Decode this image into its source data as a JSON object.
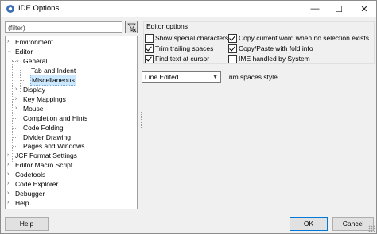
{
  "window": {
    "title": "IDE Options",
    "controls": {
      "minimize": "—",
      "maximize": "☐",
      "close": "✕"
    }
  },
  "filter": {
    "value": "(filter)"
  },
  "tree": {
    "items": [
      {
        "label": "Environment",
        "expander": "›"
      },
      {
        "label": "Editor",
        "expander": "⌄"
      },
      {
        "label": "General",
        "expander": "⌄"
      },
      {
        "label": "Tab and Indent"
      },
      {
        "label": "Miscellaneous",
        "selected": true
      },
      {
        "label": "Display",
        "expander": "›"
      },
      {
        "label": "Key Mappings",
        "expander": "›"
      },
      {
        "label": "Mouse",
        "expander": "›"
      },
      {
        "label": "Completion and Hints"
      },
      {
        "label": "Code Folding"
      },
      {
        "label": "Divider Drawing"
      },
      {
        "label": "Pages and Windows"
      },
      {
        "label": "JCF Format Settings",
        "expander": "›"
      },
      {
        "label": "Editor Macro Script",
        "expander": "›"
      },
      {
        "label": "Codetools",
        "expander": "›"
      },
      {
        "label": "Code Explorer",
        "expander": "›"
      },
      {
        "label": "Debugger",
        "expander": "›"
      },
      {
        "label": "Help",
        "expander": "›"
      }
    ]
  },
  "editor_options": {
    "title": "Editor options",
    "checkboxes": [
      {
        "label": "Show special characters",
        "checked": false
      },
      {
        "label": "Copy current word when no selection exists",
        "checked": true
      },
      {
        "label": "Trim trailing spaces",
        "checked": true
      },
      {
        "label": "Copy/Paste with fold info",
        "checked": true
      },
      {
        "label": "Find text at cursor",
        "checked": true
      },
      {
        "label": "IME handled by System",
        "checked": false
      }
    ]
  },
  "trim_style": {
    "selected": "Line Edited",
    "label": "Trim spaces style"
  },
  "buttons": {
    "help": "Help",
    "ok": "OK",
    "cancel": "Cancel"
  }
}
